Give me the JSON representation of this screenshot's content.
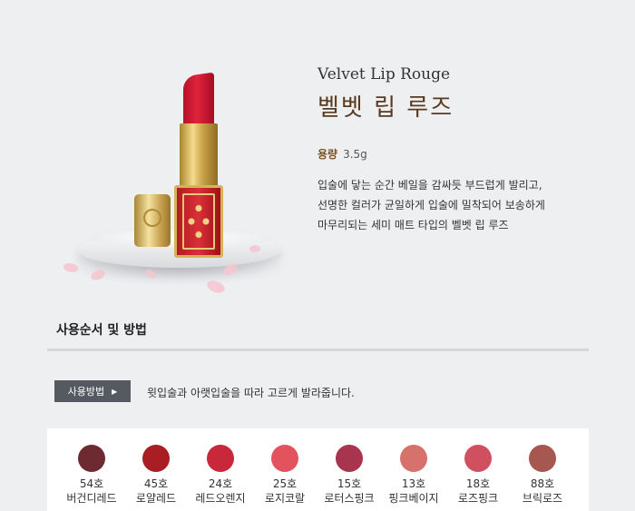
{
  "product": {
    "title_en": "Velvet Lip Rouge",
    "title_ko": "벨벳 립 루즈",
    "capacity_label": "용량",
    "capacity_value": "3.5g",
    "description": [
      "입술에 닿는 순간 베일을 감싸듯 부드럽게 발리고,",
      "선명한 컬러가 균일하게 입술에 밀착되어 보송하게",
      "마무리되는 세미 매트 타입의 벨벳 립 루즈"
    ]
  },
  "usage": {
    "section_title": "사용순서 및 방법",
    "badge_label": "사용방법",
    "badge_arrow": "▶",
    "instruction": "윗입술과 아랫입술을 따라 고르게 발라줍니다."
  },
  "swatches": [
    {
      "num": "54호",
      "name": "버건디레드",
      "color": "#6e2a31"
    },
    {
      "num": "45호",
      "name": "로얄레드",
      "color": "#a81e22"
    },
    {
      "num": "24호",
      "name": "레드오렌지",
      "color": "#c9283a"
    },
    {
      "num": "25호",
      "name": "로지코랄",
      "color": "#e2535e"
    },
    {
      "num": "15호",
      "name": "로터스핑크",
      "color": "#a8344e"
    },
    {
      "num": "13호",
      "name": "핑크베이지",
      "color": "#d7716c"
    },
    {
      "num": "18호",
      "name": "로즈핑크",
      "color": "#d0505f"
    },
    {
      "num": "88호",
      "name": "브릭로즈",
      "color": "#a6574f"
    }
  ],
  "colors": {
    "background": "#eeeff1",
    "title_brown": "#5a3a1e",
    "badge_bg": "#555a61"
  }
}
